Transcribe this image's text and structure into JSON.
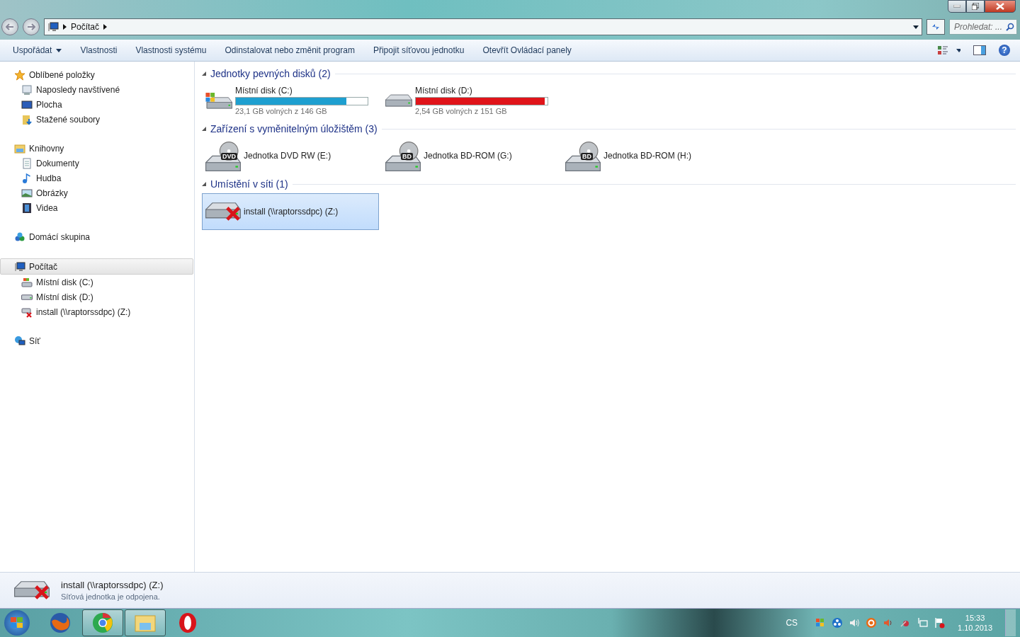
{
  "address": {
    "crumbs": [
      "Počítač"
    ]
  },
  "search": {
    "placeholder": "Prohledat: ..."
  },
  "help": {
    "label": "?"
  },
  "commands": [
    {
      "label": "Uspořádat",
      "dropdown": true
    },
    {
      "label": "Vlastnosti",
      "dropdown": false
    },
    {
      "label": "Vlastnosti systému",
      "dropdown": false
    },
    {
      "label": "Odinstalovat nebo změnit program",
      "dropdown": false
    },
    {
      "label": "Připojit síťovou jednotku",
      "dropdown": false
    },
    {
      "label": "Otevřít Ovládací panely",
      "dropdown": false
    }
  ],
  "sidebar": [
    {
      "label": "Oblíbené položky",
      "kind": "star",
      "selected": false,
      "children": [
        {
          "label": "Naposledy navštívené",
          "kind": "recent"
        },
        {
          "label": "Plocha",
          "kind": "desktop"
        },
        {
          "label": "Stažené soubory",
          "kind": "downloads"
        }
      ]
    },
    {
      "label": "Knihovny",
      "kind": "library",
      "selected": false,
      "children": [
        {
          "label": "Dokumenty",
          "kind": "document"
        },
        {
          "label": "Hudba",
          "kind": "music"
        },
        {
          "label": "Obrázky",
          "kind": "pictures"
        },
        {
          "label": "Videa",
          "kind": "video"
        }
      ]
    },
    {
      "label": "Domácí skupina",
      "kind": "homegroup",
      "selected": false
    },
    {
      "label": "Počítač",
      "kind": "computer",
      "selected": true,
      "children": [
        {
          "label": "Místní disk (C:)",
          "kind": "system-disk"
        },
        {
          "label": "Místní disk (D:)",
          "kind": "disk"
        },
        {
          "label": "install (\\\\raptorssdpc) (Z:)",
          "kind": "network"
        }
      ]
    },
    {
      "label": "Síť",
      "kind": "network-globe",
      "selected": false
    }
  ],
  "sections": [
    {
      "title": "Jednotky pevných disků (2)",
      "expanded": true,
      "items": [
        {
          "kind": "system-disk",
          "label": "Místní disk (C:)",
          "level": 0.84,
          "color": "#1e9fd0",
          "free": "23,1 GB volných z 146 GB",
          "selected": false
        },
        {
          "kind": "disk",
          "label": "Místní disk (D:)",
          "level": 0.98,
          "color": "#e0141a",
          "free": "2,54 GB volných z 151 GB",
          "selected": false
        }
      ]
    },
    {
      "title": "Zařízení s vyměnitelným úložištěm (3)",
      "expanded": true,
      "items": [
        {
          "kind": "optical",
          "badge": "DVD",
          "label": "Jednotka DVD RW (E:)",
          "selected": false
        },
        {
          "kind": "optical",
          "badge": "BD",
          "label": "Jednotka BD-ROM (G:)",
          "selected": false
        },
        {
          "kind": "optical",
          "badge": "BD",
          "label": "Jednotka BD-ROM (H:)",
          "selected": false
        }
      ]
    },
    {
      "title": "Umístění v síti (1)",
      "expanded": true,
      "items": [
        {
          "kind": "network",
          "label": "install (\\\\raptorssdpc) (Z:)",
          "selected": true
        }
      ]
    }
  ],
  "details": {
    "kind": "network",
    "title": "install (\\\\raptorssdpc) (Z:)",
    "status": "Síťová jednotka je odpojena."
  },
  "taskbar": {
    "apps": [
      {
        "kind": "firefox",
        "running": false
      },
      {
        "kind": "chrome",
        "running": true
      },
      {
        "kind": "explorer",
        "running": true
      },
      {
        "kind": "opera",
        "running": false
      }
    ],
    "language": "CS",
    "tray": [
      {
        "kind": "windows-flag"
      },
      {
        "kind": "bluetooth"
      },
      {
        "kind": "speaker"
      },
      {
        "kind": "orange-circle"
      },
      {
        "kind": "speaker-muted"
      },
      {
        "kind": "network-tool"
      },
      {
        "kind": "monitor"
      },
      {
        "kind": "flag-error"
      }
    ],
    "time": "15:33",
    "date": "1.10.2013"
  }
}
